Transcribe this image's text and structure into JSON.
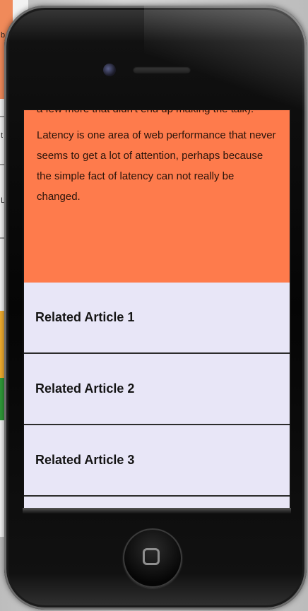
{
  "article": {
    "paragraphs": [
      "a few more that didn't end up making the talk).",
      "Latency is one area of web performance that never seems to get a lot of attention, perhaps because the simple fact of latency can not really be changed."
    ]
  },
  "related": {
    "items": [
      {
        "label": "Related Article 1"
      },
      {
        "label": "Related Article 2"
      },
      {
        "label": "Related Article 3"
      }
    ]
  },
  "background_page": {
    "fragments": [
      "b",
      "t",
      "L"
    ]
  },
  "colors": {
    "article_background": "#fe7b4c",
    "list_background": "#e8e6f7",
    "phone_body": "#050505"
  },
  "icons": {
    "camera": "camera-icon",
    "speaker": "speaker-grille",
    "home": "home-button-icon"
  }
}
